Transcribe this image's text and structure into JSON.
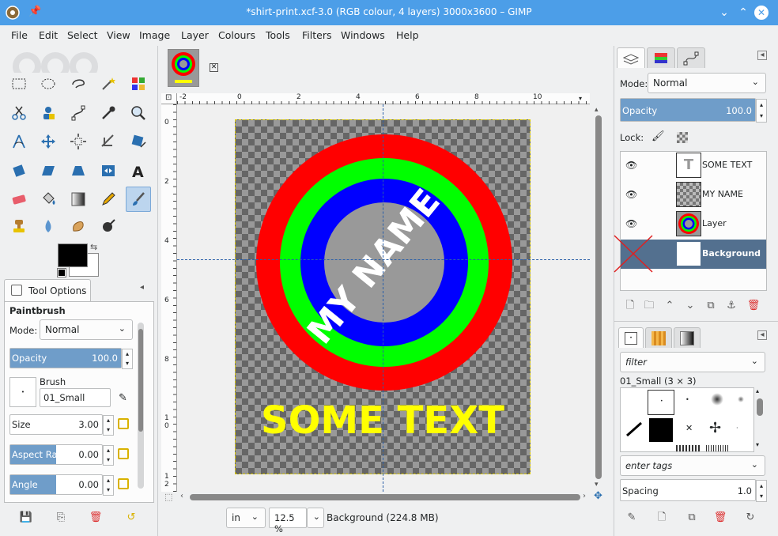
{
  "window": {
    "title": "*shirt-print.xcf-3.0 (RGB colour, 4 layers) 3000x3600 – GIMP"
  },
  "menu": [
    "File",
    "Edit",
    "Select",
    "View",
    "Image",
    "Layer",
    "Colours",
    "Tools",
    "Filters",
    "Windows",
    "Help"
  ],
  "tool_options": {
    "tab_label": "Tool Options",
    "tool_name": "Paintbrush",
    "mode_label": "Mode:",
    "mode_value": "Normal",
    "opacity_label": "Opacity",
    "opacity_value": "100.0",
    "opacity_fraction": 1.0,
    "brush_label": "Brush",
    "brush_value": "01_Small",
    "size_label": "Size",
    "size_value": "3.00",
    "aspect_label": "Aspect Ratio",
    "aspect_value": "0.00",
    "angle_label": "Angle",
    "angle_value": "0.00"
  },
  "canvas": {
    "ruler_top_labels": [
      "-2",
      "0",
      "2",
      "4",
      "6",
      "8",
      "10"
    ],
    "ruler_left_labels": [
      "0",
      "2",
      "4",
      "6",
      "8",
      "1\n0",
      "1\n2"
    ],
    "artwork_text_arc": "MY NAME",
    "artwork_text_bottom": "SOME TEXT",
    "colors": {
      "red": "#ff0000",
      "green": "#00ff00",
      "blue": "#0000ff",
      "yellow": "#ffff00"
    }
  },
  "status": {
    "unit": "in",
    "zoom": "12.5 %",
    "info": "Background (224.8 MB)"
  },
  "layers": {
    "mode_label": "Mode:",
    "mode_value": "Normal",
    "opacity_label": "Opacity",
    "opacity_value": "100.0",
    "lock_label": "Lock:",
    "items": [
      {
        "name": "SOME TEXT",
        "visible": true,
        "selected": false
      },
      {
        "name": "MY NAME",
        "visible": true,
        "selected": false
      },
      {
        "name": "Layer",
        "visible": true,
        "selected": false
      },
      {
        "name": "Background",
        "visible": false,
        "selected": true
      }
    ]
  },
  "brushes": {
    "filter_placeholder": "filter",
    "current": "01_Small (3 × 3)",
    "tags_placeholder": "enter tags",
    "spacing_label": "Spacing",
    "spacing_value": "1.0"
  }
}
